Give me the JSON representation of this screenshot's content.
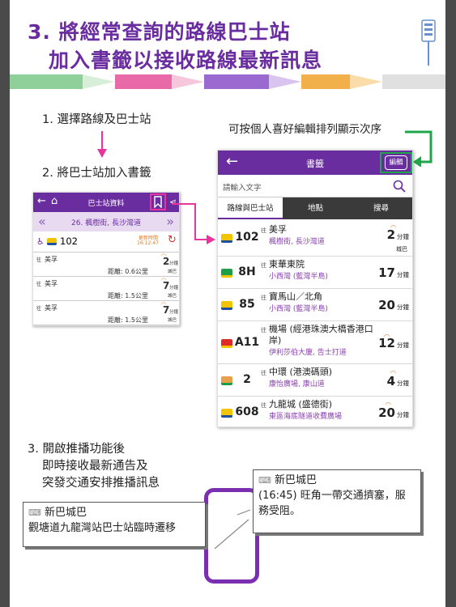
{
  "header": {
    "line1": "3. 將經常查詢的路線巴士站",
    "line2": "加入書籤以接收路線最新訊息"
  },
  "steps": {
    "step1": "1. 選擇路線及巴士站",
    "step2": "2. 將巴士站加入書籤",
    "reorder_note": "可按個人喜好編輯排列顯示次序",
    "step3_line1": "3. 開啟推播功能後",
    "step3_line2": "即時接收最新通告及",
    "step3_line3": "突發交通安排推播訊息"
  },
  "left_screen": {
    "title": "巴士站資料",
    "stop_name": "26. 楓樹街, 長沙灣道",
    "route": "102",
    "update_label": "更新時間",
    "update_time": "16:12:47",
    "items": [
      {
        "via": "往",
        "dest": "美孚",
        "distance": "距離: 0.6公里",
        "eta": "2",
        "unit": "分鐘",
        "note": "城巴"
      },
      {
        "via": "往",
        "dest": "美孚",
        "distance": "距離: 1.5公里",
        "eta": "7",
        "unit": "分鐘",
        "note": "城巴"
      },
      {
        "via": "往",
        "dest": "美孚",
        "distance": "距離: 1.5公里",
        "eta": "7",
        "unit": "分鐘",
        "note": "城巴"
      }
    ]
  },
  "right_screen": {
    "title": "書籤",
    "edit_label": "編輯",
    "search_placeholder": "請輸入文字",
    "tabs": [
      "路線與巴士站",
      "地點",
      "搜尋"
    ],
    "rows": [
      {
        "route": "102",
        "via": "往",
        "dest": "美孚",
        "stop": "楓樹街, 長沙灣道",
        "eta": "2",
        "unit": "分鐘",
        "note": "城巴",
        "color": "#f2c300"
      },
      {
        "route": "8H",
        "via": "往",
        "dest": "東華東院",
        "stop": "小西灣 (藍灣半島)",
        "eta": "17",
        "unit": "分鐘",
        "note": "",
        "color": "#1f9e4a"
      },
      {
        "route": "85",
        "via": "往",
        "dest": "寶馬山／北角",
        "stop": "小西灣 (藍灣半島)",
        "eta": "20",
        "unit": "分鐘",
        "note": "",
        "color": "#f2c300"
      },
      {
        "route": "A11",
        "via": "往",
        "dest": "機場 (經港珠澳大橋香港口岸)",
        "stop": "伊利莎伯大廈, 告士打道",
        "eta": "12",
        "unit": "分鐘",
        "note": "",
        "color": "#e02a2a"
      },
      {
        "route": "2",
        "via": "往",
        "dest": "中環 (港澳碼頭)",
        "stop": "康怡廣場, 康山道",
        "eta": "4",
        "unit": "分鐘",
        "note": "",
        "color": "#e8a04a"
      },
      {
        "route": "608",
        "via": "往",
        "dest": "九龍城 (盛德街)",
        "stop": "東區海底隧道收費廣場",
        "eta": "20",
        "unit": "分鐘",
        "note": "",
        "color": "#f2c300"
      }
    ]
  },
  "notifications": [
    {
      "title": "新巴城巴",
      "body": "觀塘道九龍灣站巴士站臨時遷移"
    },
    {
      "title": "新巴城巴",
      "body_line1": "(16:45) 旺角一帶交通擠塞，服",
      "body_line2": "務受阻。"
    }
  ],
  "colors": {
    "brand_purple": "#6a2da0",
    "highlight_pink": "#e8359c",
    "highlight_green": "#1fa64a",
    "eta_orange": "#e07a1f"
  }
}
